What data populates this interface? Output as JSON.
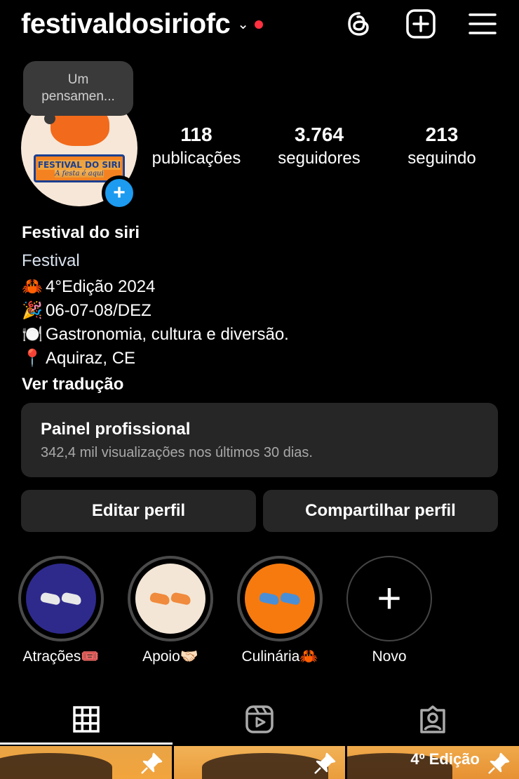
{
  "header": {
    "username": "festivaldosiriofc"
  },
  "note": {
    "text_line1": "Um",
    "text_line2": "pensamen..."
  },
  "stats": [
    {
      "value": "118",
      "label": "publicações"
    },
    {
      "value": "3.764",
      "label": "seguidores"
    },
    {
      "value": "213",
      "label": "seguindo"
    }
  ],
  "bio": {
    "name": "Festival do siri",
    "category": "Festival",
    "lines": [
      {
        "emoji": "🦀",
        "text": "4°Edição 2024"
      },
      {
        "emoji": "🎉",
        "text": "06-07-08/DEZ"
      },
      {
        "emoji": "🍽️",
        "text": "Gastronomia, cultura e diversão."
      },
      {
        "emoji": "📍",
        "text": "Aquiraz, CE"
      }
    ],
    "translate": "Ver tradução"
  },
  "panel": {
    "title": "Painel profissional",
    "subtitle": "342,4 mil visualizações nos últimos 30 dias."
  },
  "buttons": {
    "edit": "Editar perfil",
    "share": "Compartilhar perfil"
  },
  "highlights": [
    {
      "label": "Atrações🎟️",
      "bg": "#2e2a8c",
      "shoe": "#e8e8e8"
    },
    {
      "label": "Apoio🤝🏻",
      "bg": "#f3e6d6",
      "shoe": "#f08a3c"
    },
    {
      "label": "Culinária🦀",
      "bg": "#f77a0f",
      "shoe": "#4a8fd6"
    },
    {
      "label": "Novo"
    }
  ],
  "grid_overlay": {
    "post3_text": "4º Edição"
  },
  "colors": {
    "accent": "#1c9bf0",
    "notification": "#ff3040",
    "surface": "#262626"
  }
}
